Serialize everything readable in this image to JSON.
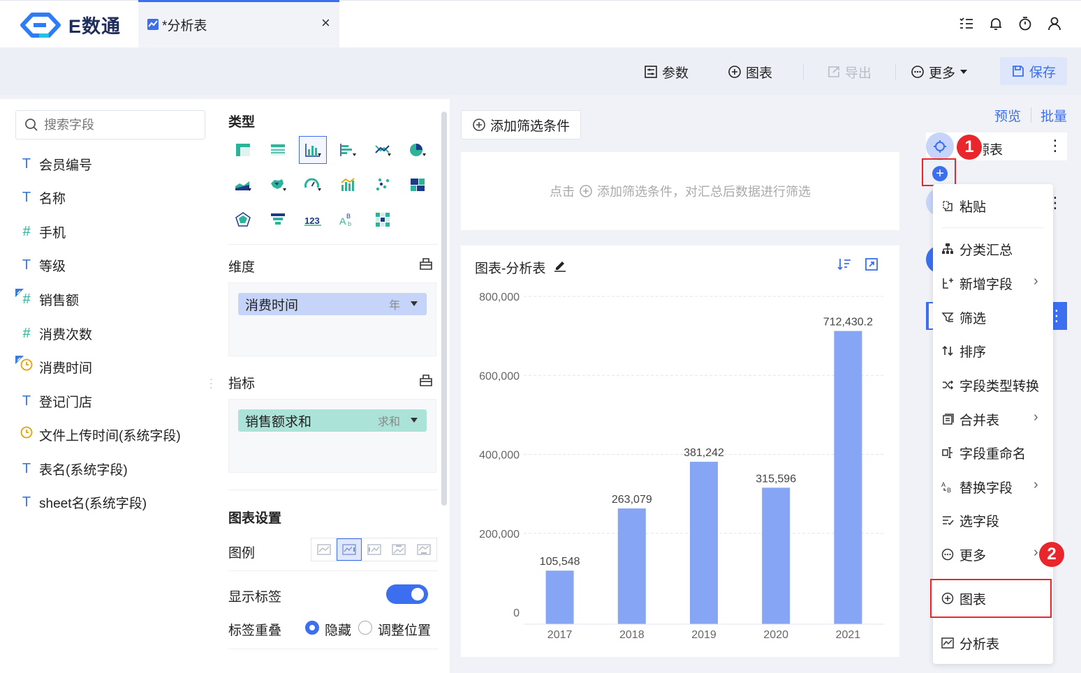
{
  "brand": {
    "name": "E数通",
    "blue": "#3b6ff0",
    "red": "#e8262c"
  },
  "tab": {
    "title": "*分析表",
    "close": "×"
  },
  "toolbar": {
    "params": "参数",
    "chart": "图表",
    "export": "导出",
    "more": "更多",
    "save": "保存"
  },
  "fields": {
    "search_placeholder": "搜索字段",
    "items": [
      {
        "label": "会员编号",
        "icon": "text-icon"
      },
      {
        "label": "名称",
        "icon": "text-icon"
      },
      {
        "label": "手机",
        "icon": "number-icon"
      },
      {
        "label": "等级",
        "icon": "text-icon"
      },
      {
        "label": "销售额",
        "icon": "number-icon"
      },
      {
        "label": "消费次数",
        "icon": "number-icon"
      },
      {
        "label": "消费时间",
        "icon": "time-icon"
      },
      {
        "label": "登记门店",
        "icon": "text-icon"
      },
      {
        "label": "文件上传时间(系统字段)",
        "icon": "time-icon"
      },
      {
        "label": "表名(系统字段)",
        "icon": "text-icon"
      },
      {
        "label": "sheet名(系统字段)",
        "icon": "text-icon"
      }
    ]
  },
  "config": {
    "type_title": "类型",
    "dimension_title": "维度",
    "dimension_pill": {
      "label": "消费时间",
      "suffix": "年"
    },
    "measure_title": "指标",
    "measure_pill": {
      "label": "销售额求和",
      "suffix": "求和"
    },
    "settings_title": "图表设置",
    "legend_label": "图例",
    "show_labels": "显示标签",
    "show_labels_on": true,
    "overlap_label": "标签重叠",
    "overlap_hide": "隐藏",
    "overlap_adjust": "调整位置"
  },
  "filter": {
    "add_button": "添加筛选条件",
    "hint_prefix": "点击",
    "hint_suffix": "添加筛选条件，对汇总后数据进行筛选"
  },
  "chart_data": {
    "type": "bar",
    "title": "图表-分析表",
    "categories": [
      "2017",
      "2018",
      "2019",
      "2020",
      "2021"
    ],
    "values": [
      105548,
      263079,
      381242,
      315596,
      712430.2
    ],
    "labels": [
      "105,548",
      "263,079",
      "381,242",
      "315,596",
      "712,430.2"
    ],
    "yticks": [
      "0",
      "200,000",
      "400,000",
      "600,000",
      "800,000"
    ],
    "ylim": [
      0,
      800000
    ],
    "bar_color": "#86a5f5",
    "grid": true
  },
  "right": {
    "preview": "预览",
    "batch": "批量",
    "node_label": "源表",
    "menu": [
      {
        "label": "粘贴",
        "icon": "paste-icon",
        "sub": false
      },
      {
        "label": "分类汇总",
        "icon": "group-icon",
        "sub": false
      },
      {
        "label": "新增字段",
        "icon": "add-field-icon",
        "sub": true
      },
      {
        "label": "筛选",
        "icon": "filter-icon",
        "sub": false
      },
      {
        "label": "排序",
        "icon": "sort-icon",
        "sub": false
      },
      {
        "label": "字段类型转换",
        "icon": "convert-icon",
        "sub": false
      },
      {
        "label": "合并表",
        "icon": "merge-icon",
        "sub": true
      },
      {
        "label": "字段重命名",
        "icon": "rename-icon",
        "sub": false
      },
      {
        "label": "替换字段",
        "icon": "replace-icon",
        "sub": true
      },
      {
        "label": "选字段",
        "icon": "select-field-icon",
        "sub": false
      },
      {
        "label": "更多",
        "icon": "more-icon",
        "sub": true
      },
      {
        "label": "图表",
        "icon": "chart-plus-icon",
        "sub": false
      },
      {
        "label": "分析表",
        "icon": "analysis-icon",
        "sub": false
      }
    ],
    "badge1": "1",
    "badge2": "2"
  }
}
